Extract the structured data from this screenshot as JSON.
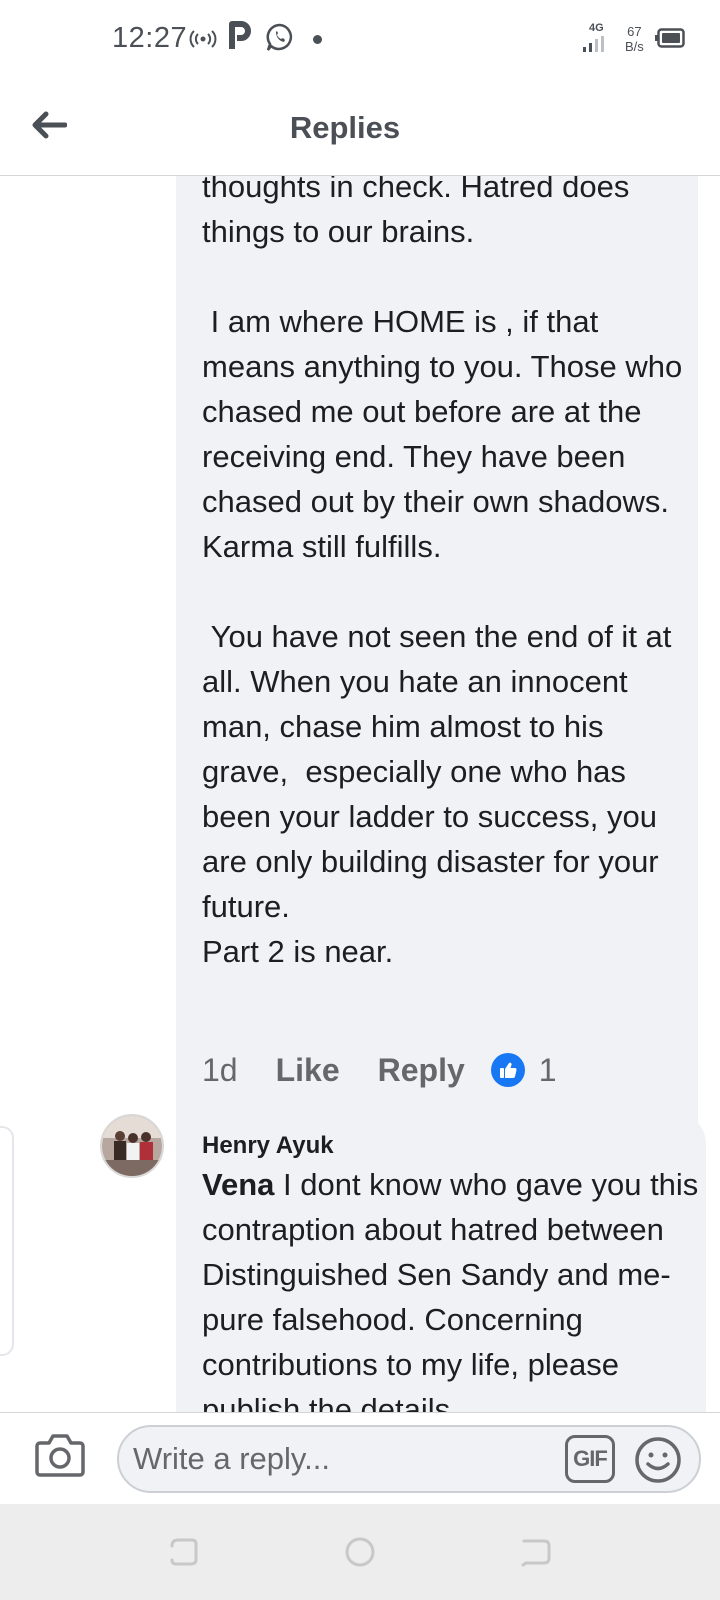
{
  "status_bar": {
    "time": "12:27",
    "network_type": "4G",
    "speed_value": "67",
    "speed_unit": "B/s",
    "icons": [
      "hotspot-icon",
      "p-app-icon",
      "whatsapp-icon",
      "notification-dot-icon",
      "signal-icon",
      "battery-icon"
    ]
  },
  "header": {
    "title": "Replies",
    "back_icon": "back-arrow-icon"
  },
  "comments": [
    {
      "text": "thoughts in check. Hatred does things to our brains.\n\n I am where HOME is , if that means anything to you. Those who chased me out before are at the receiving end. They have been chased out by their own shadows. Karma still fulfills.\n\n You have not seen the end of it at all. When you hate an innocent man, chase him almost to his grave,  especially one who has been your ladder to success, you are only building disaster for your future.\nPart 2 is near.",
      "time_ago": "1d",
      "like_label": "Like",
      "reply_label": "Reply",
      "reaction_icon": "like-reaction-icon",
      "reaction_count": "1"
    },
    {
      "author": "Henry Ayuk",
      "mention": "Vena",
      "text": " I dont know who gave you this contraption about hatred between Distinguished Sen Sandy and me- pure falsehood. Concerning contributions to my life, please publish the details"
    }
  ],
  "composer": {
    "placeholder": "Write a reply...",
    "gif_label": "GIF",
    "camera_icon": "camera-icon",
    "emoji_icon": "emoji-icon"
  },
  "colors": {
    "bubble_bg": "#f0f2f5",
    "text_primary": "#1c1e21",
    "text_secondary": "#65676b",
    "like_blue": "#1877f2"
  }
}
